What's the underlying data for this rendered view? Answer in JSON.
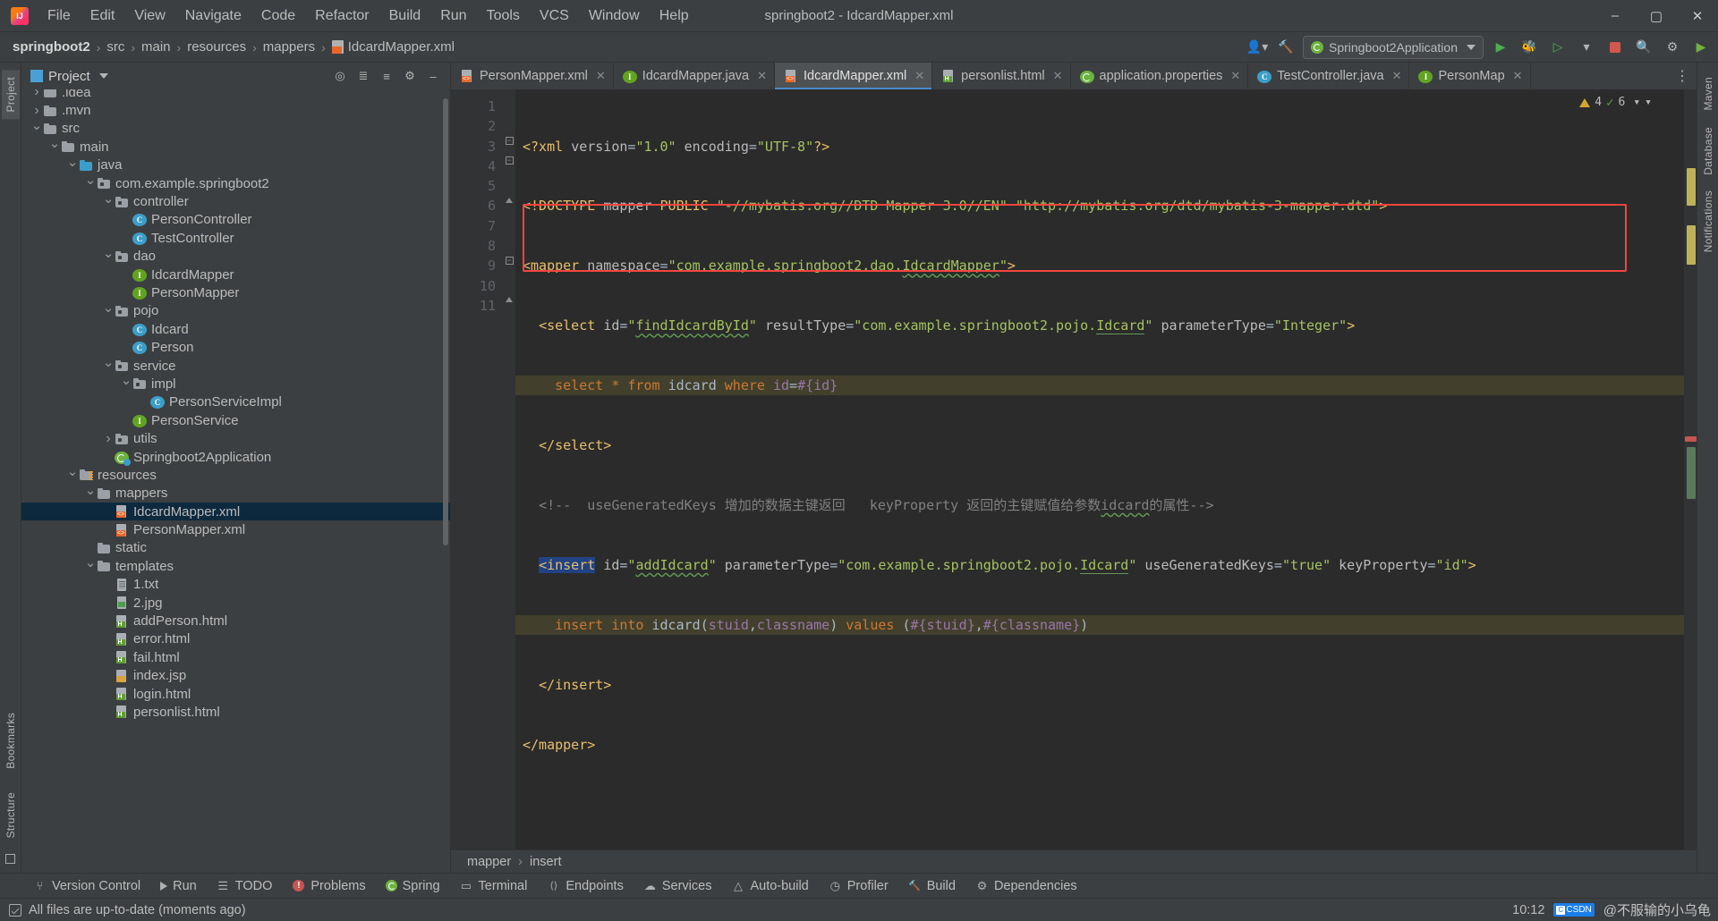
{
  "window": {
    "title": "springboot2 - IdcardMapper.xml",
    "logo_alt": "intellij-idea-logo",
    "minimize": "–",
    "maximize": "▢",
    "close": "✕"
  },
  "menu": [
    {
      "label": "File"
    },
    {
      "label": "Edit"
    },
    {
      "label": "View"
    },
    {
      "label": "Navigate"
    },
    {
      "label": "Code"
    },
    {
      "label": "Refactor"
    },
    {
      "label": "Build"
    },
    {
      "label": "Run"
    },
    {
      "label": "Tools"
    },
    {
      "label": "VCS"
    },
    {
      "label": "Window"
    },
    {
      "label": "Help"
    }
  ],
  "breadcrumb": {
    "items": [
      "springboot2",
      "src",
      "main",
      "resources",
      "mappers",
      "IdcardMapper.xml"
    ],
    "separator": "›"
  },
  "navbar_right": {
    "run_config": "Springboot2Application",
    "search_icon": "search-icon",
    "settings_icon": "gear-icon",
    "updates_icon": "update-icon"
  },
  "project_panel": {
    "title": "Project",
    "dropdown_icon": "chevron-down-icon",
    "actions": [
      "locate-icon",
      "expand-all-icon",
      "collapse-all-icon",
      "settings-icon",
      "hide-icon"
    ],
    "tree": [
      {
        "label": ".idea",
        "depth": 2,
        "arrow": "right",
        "icon": "folder",
        "sel": false,
        "clipped": true
      },
      {
        "label": ".mvn",
        "depth": 2,
        "arrow": "right",
        "icon": "folder",
        "sel": false
      },
      {
        "label": "src",
        "depth": 2,
        "arrow": "down",
        "icon": "folder",
        "sel": false
      },
      {
        "label": "main",
        "depth": 3,
        "arrow": "down",
        "icon": "folder",
        "sel": false
      },
      {
        "label": "java",
        "depth": 4,
        "arrow": "down",
        "icon": "folder-blue",
        "sel": false
      },
      {
        "label": "com.example.springboot2",
        "depth": 5,
        "arrow": "down",
        "icon": "package",
        "sel": false
      },
      {
        "label": "controller",
        "depth": 6,
        "arrow": "down",
        "icon": "package",
        "sel": false
      },
      {
        "label": "PersonController",
        "depth": 7,
        "arrow": "none",
        "icon": "class",
        "sel": false
      },
      {
        "label": "TestController",
        "depth": 7,
        "arrow": "none",
        "icon": "class",
        "sel": false
      },
      {
        "label": "dao",
        "depth": 6,
        "arrow": "down",
        "icon": "package",
        "sel": false
      },
      {
        "label": "IdcardMapper",
        "depth": 7,
        "arrow": "none",
        "icon": "interface",
        "sel": false
      },
      {
        "label": "PersonMapper",
        "depth": 7,
        "arrow": "none",
        "icon": "interface",
        "sel": false
      },
      {
        "label": "pojo",
        "depth": 6,
        "arrow": "down",
        "icon": "package",
        "sel": false
      },
      {
        "label": "Idcard",
        "depth": 7,
        "arrow": "none",
        "icon": "class",
        "sel": false
      },
      {
        "label": "Person",
        "depth": 7,
        "arrow": "none",
        "icon": "class",
        "sel": false
      },
      {
        "label": "service",
        "depth": 6,
        "arrow": "down",
        "icon": "package",
        "sel": false
      },
      {
        "label": "impl",
        "depth": 7,
        "arrow": "down",
        "icon": "package",
        "sel": false
      },
      {
        "label": "PersonServiceImpl",
        "depth": 8,
        "arrow": "none",
        "icon": "class",
        "sel": false
      },
      {
        "label": "PersonService",
        "depth": 7,
        "arrow": "none",
        "icon": "interface",
        "sel": false
      },
      {
        "label": "utils",
        "depth": 6,
        "arrow": "right",
        "icon": "package",
        "sel": false
      },
      {
        "label": "Springboot2Application",
        "depth": 6,
        "arrow": "none",
        "icon": "spring",
        "sel": false
      },
      {
        "label": "resources",
        "depth": 4,
        "arrow": "down",
        "icon": "folder-res",
        "sel": false
      },
      {
        "label": "mappers",
        "depth": 5,
        "arrow": "down",
        "icon": "folder",
        "sel": false
      },
      {
        "label": "IdcardMapper.xml",
        "depth": 6,
        "arrow": "none",
        "icon": "xml",
        "sel": true
      },
      {
        "label": "PersonMapper.xml",
        "depth": 6,
        "arrow": "none",
        "icon": "xml",
        "sel": false
      },
      {
        "label": "static",
        "depth": 5,
        "arrow": "none",
        "icon": "folder",
        "sel": false
      },
      {
        "label": "templates",
        "depth": 5,
        "arrow": "down",
        "icon": "folder",
        "sel": false
      },
      {
        "label": "1.txt",
        "depth": 6,
        "arrow": "none",
        "icon": "txt",
        "sel": false
      },
      {
        "label": "2.jpg",
        "depth": 6,
        "arrow": "none",
        "icon": "jpg",
        "sel": false
      },
      {
        "label": "addPerson.html",
        "depth": 6,
        "arrow": "none",
        "icon": "html",
        "sel": false
      },
      {
        "label": "error.html",
        "depth": 6,
        "arrow": "none",
        "icon": "html",
        "sel": false
      },
      {
        "label": "fail.html",
        "depth": 6,
        "arrow": "none",
        "icon": "html",
        "sel": false
      },
      {
        "label": "index.jsp",
        "depth": 6,
        "arrow": "none",
        "icon": "jsp",
        "sel": false
      },
      {
        "label": "login.html",
        "depth": 6,
        "arrow": "none",
        "icon": "html",
        "sel": false
      },
      {
        "label": "personlist.html",
        "depth": 6,
        "arrow": "none",
        "icon": "html",
        "sel": false
      }
    ]
  },
  "left_strip": [
    {
      "label": "Project",
      "active": true
    },
    {
      "label": "Bookmarks",
      "active": false
    },
    {
      "label": "Structure",
      "active": false
    }
  ],
  "right_strip": [
    {
      "label": "Maven"
    },
    {
      "label": "Database"
    },
    {
      "label": "Notifications"
    }
  ],
  "editor_tabs": [
    {
      "label": "PersonMapper.xml",
      "icon": "xml-file-icon",
      "active": false
    },
    {
      "label": "IdcardMapper.java",
      "icon": "interface-icon",
      "active": false
    },
    {
      "label": "IdcardMapper.xml",
      "icon": "xml-file-icon",
      "active": true
    },
    {
      "label": "personlist.html",
      "icon": "html-file-icon",
      "active": false
    },
    {
      "label": "application.properties",
      "icon": "spring-icon",
      "active": false
    },
    {
      "label": "TestController.java",
      "icon": "class-icon",
      "active": false
    },
    {
      "label": "PersonMap",
      "icon": "interface-icon",
      "active": false
    }
  ],
  "tab_overflow_icon": "more-tabs-icon",
  "inspections": {
    "warnings": "4",
    "oks": "6",
    "warn_icon": "warning-triangle-icon",
    "ok_icon": "checkmark-icon",
    "chevron_icon": "chevron-down-icon"
  },
  "code": {
    "line_numbers": [
      "1",
      "2",
      "3",
      "4",
      "5",
      "6",
      "7",
      "8",
      "9",
      "10",
      "11"
    ],
    "lines": [
      "<?xml version=\"1.0\" encoding=\"UTF-8\"?>",
      "<!DOCTYPE mapper PUBLIC \"-//mybatis.org//DTD Mapper 3.0//EN\" \"http://mybatis.org/dtd/mybatis-3-mapper.dtd\">",
      "<mapper namespace=\"com.example.springboot2.dao.IdcardMapper\">",
      "    <select id=\"findIdcardById\" resultType=\"com.example.springboot2.pojo.Idcard\" parameterType=\"Integer\">",
      "        select * from idcard where id=#{id}",
      "    </select>",
      "    <!--  useGeneratedKeys 增加的数据主键返回   keyProperty 返回的主键赋值给参数idcard的属性-->",
      "    <insert id=\"addIdcard\" parameterType=\"com.example.springboot2.pojo.Idcard\" useGeneratedKeys=\"true\" keyProperty=\"id\">",
      "        insert into idcard(stuid,classname) values (#{stuid},#{classname})",
      "    </insert>",
      "</mapper>"
    ]
  },
  "editor_breadcrumb": {
    "items": [
      "mapper",
      "insert"
    ],
    "separator": "›"
  },
  "bottom_tools": [
    {
      "label": "Version Control",
      "icon": "branch-icon"
    },
    {
      "label": "Run",
      "icon": "run-icon"
    },
    {
      "label": "TODO",
      "icon": "todo-icon"
    },
    {
      "label": "Problems",
      "icon": "problems-icon"
    },
    {
      "label": "Spring",
      "icon": "spring-icon"
    },
    {
      "label": "Terminal",
      "icon": "terminal-icon"
    },
    {
      "label": "Endpoints",
      "icon": "endpoints-icon"
    },
    {
      "label": "Services",
      "icon": "services-icon"
    },
    {
      "label": "Auto-build",
      "icon": "autobuild-icon"
    },
    {
      "label": "Profiler",
      "icon": "profiler-icon"
    },
    {
      "label": "Build",
      "icon": "build-icon"
    },
    {
      "label": "Dependencies",
      "icon": "dependencies-icon"
    }
  ],
  "statusbar": {
    "message": "All files are up-to-date (moments ago)",
    "icon": "sync-ok-icon",
    "time": "10:12",
    "watermark": "@不服输的小乌龟",
    "watermark_badge": "CSDN"
  },
  "colors": {
    "accent": "#4a88c7",
    "selection": "#0d293e",
    "highlight_box": "#f4443f",
    "sql_highlight": "#42402c",
    "panel_bg": "#3c3f41",
    "editor_bg": "#2b2b2b",
    "gutter_bg": "#313335"
  }
}
